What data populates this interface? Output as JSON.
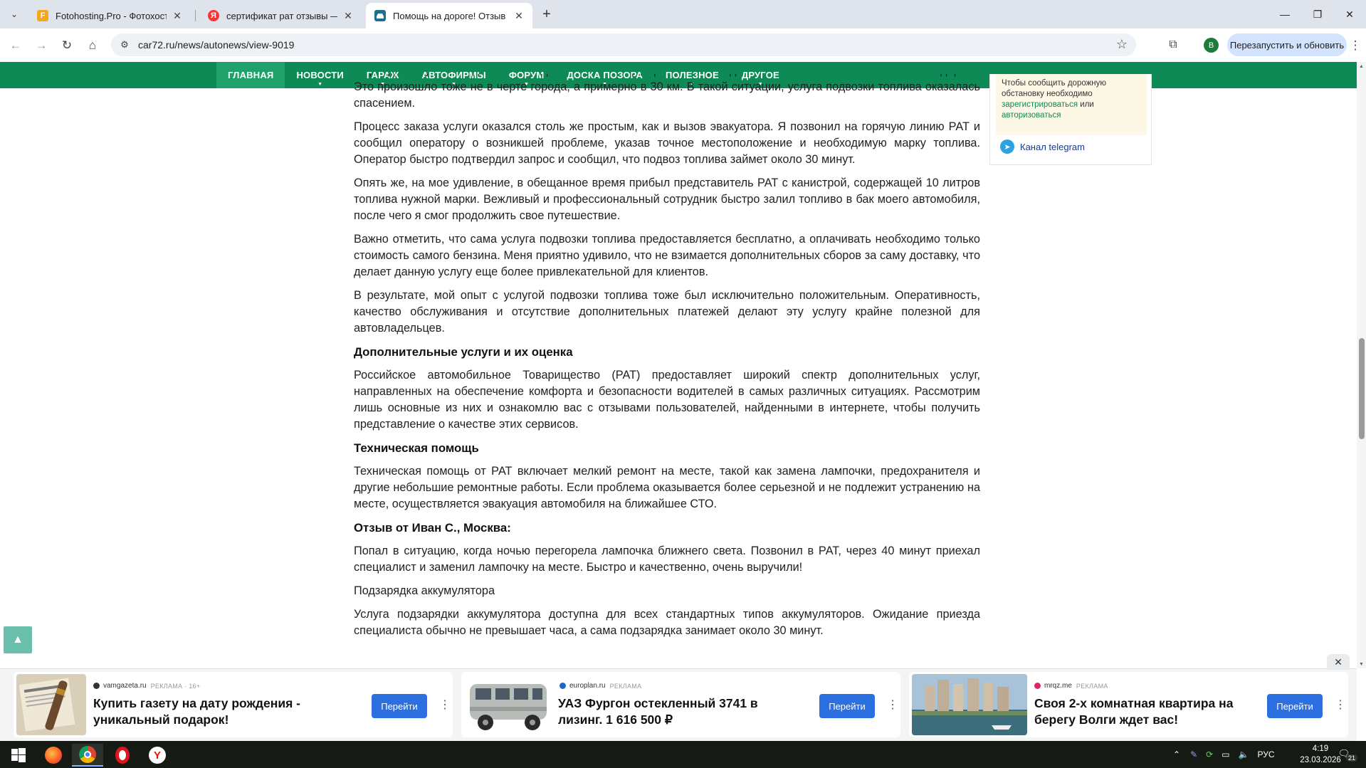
{
  "browser": {
    "tabs": [
      {
        "title": "Fotohosting.Pro - Фотохостинг",
        "favicon_color": "#f2a81d",
        "favicon_text": "F",
        "active": false
      },
      {
        "title": "сертификат рат отзывы — Янд",
        "favicon_color": "#ff3333",
        "favicon_text": "Я",
        "active": false
      },
      {
        "title": "Помощь на дороге! Отзыв о к",
        "favicon_color": "#1d6f8b",
        "favicon_text": "",
        "active": true
      }
    ],
    "url": "car72.ru/news/autonews/view-9019",
    "profile_initial": "B",
    "relaunch_label": "Перезапустить и обновить"
  },
  "nav": {
    "items": [
      {
        "label": "ГЛАВНАЯ",
        "active": true,
        "caret": false
      },
      {
        "label": "НОВОСТИ",
        "active": false,
        "caret": true
      },
      {
        "label": "ГАРАЖ",
        "active": false,
        "caret": true
      },
      {
        "label": "АВТОФИРМЫ",
        "active": false,
        "caret": true
      },
      {
        "label": "ФОРУМ",
        "active": false,
        "caret": true
      },
      {
        "label": "ДОСКА ПОЗОРА",
        "active": false,
        "caret": true
      },
      {
        "label": "ПОЛЕЗНОЕ",
        "active": false,
        "caret": true
      },
      {
        "label": "ДРУГОЕ",
        "active": false,
        "caret": true
      }
    ]
  },
  "article": {
    "blocks": [
      {
        "type": "p",
        "text": "Еще один случай, когда мне понадобилась помощь, произошел, когда я внезапно остался без топлива в дороге. Это произошло тоже не в черте города, а примерно в 30 км. В такой ситуации, услуга подвозки топлива оказалась спасением."
      },
      {
        "type": "p",
        "text": "Процесс заказа услуги оказался столь же простым, как и вызов эвакуатора. Я позвонил на горячую линию РАТ и сообщил оператору о возникшей проблеме, указав точное местоположение и необходимую марку топлива. Оператор быстро подтвердил запрос и сообщил, что подвоз топлива займет около 30 минут."
      },
      {
        "type": "p",
        "text": "Опять же, на мое удивление, в обещанное время прибыл представитель РАТ с канистрой, содержащей 10 литров топлива нужной марки. Вежливый и профессиональный сотрудник быстро залил топливо в бак моего автомобиля, после чего я смог продолжить свое путешествие."
      },
      {
        "type": "p",
        "text": "Важно отметить, что сама услуга подвозки топлива предоставляется бесплатно, а оплачивать необходимо только стоимость самого бензина. Меня приятно удивило, что не взимается дополнительных сборов за саму доставку, что делает данную услугу еще более привлекательной для клиентов."
      },
      {
        "type": "p",
        "text": "В результате, мой опыт с услугой подвозки топлива тоже был исключительно положительным. Оперативность, качество обслуживания и отсутствие дополнительных платежей делают эту услугу крайне полезной для автовладельцев."
      },
      {
        "type": "h3",
        "text": "Дополнительные услуги и их оценка"
      },
      {
        "type": "p",
        "text": "Российское автомобильное Товарищество (РАТ) предоставляет широкий спектр дополнительных услуг, направленных на обеспечение комфорта и безопасности водителей в самых различных ситуациях. Рассмотрим лишь основные из них и ознакомлю вас с отзывами пользователей, найденными в интернете, чтобы получить представление о качестве этих сервисов."
      },
      {
        "type": "h3",
        "text": "Техническая помощь"
      },
      {
        "type": "p",
        "text": "Техническая помощь от РАТ включает мелкий ремонт на месте, такой как замена лампочки, предохранителя и другие небольшие ремонтные работы. Если проблема оказывается более серьезной и не подлежит устранению на месте, осуществляется эвакуация автомобиля на ближайшее СТО."
      },
      {
        "type": "h3",
        "text": "Отзыв от Иван С., Москва:"
      },
      {
        "type": "p",
        "text": "Попал в ситуацию, когда ночью перегорела лампочка ближнего света. Позвонил в РАТ, через 40 минут приехал специалист и заменил лампочку на месте. Быстро и качественно, очень выручили!"
      },
      {
        "type": "p",
        "text": "Подзарядка аккумулятора"
      },
      {
        "type": "p",
        "text": "Услуга подзарядки аккумулятора доступна для всех стандартных типов аккумуляторов. Ожидание приезда специалиста обычно не превышает часа, а сама подзарядка занимает около 30 минут."
      }
    ]
  },
  "sidebar": {
    "note_prefix": "Чтобы сообщить дорожную обстановку необходимо",
    "register_link": "зарегистрироваться",
    "or_text": "или",
    "login_link": "авторизоваться",
    "telegram_label": "Канал telegram"
  },
  "ads": [
    {
      "source": "vamgazeta.ru",
      "label": "РЕКЛАМА · 16+",
      "title": "Купить газету на дату рождения - уникальный подарок!",
      "button": "Перейти",
      "dot_color": "#333333"
    },
    {
      "source": "europlan.ru",
      "label": "РЕКЛАМА",
      "title": "УАЗ Фургон остекленный 3741 в лизинг. 1 616 500 ₽",
      "button": "Перейти",
      "dot_color": "#1e66c9"
    },
    {
      "source": "mrqz.me",
      "label": "РЕКЛАМА",
      "title": "Своя 2-х комнатная квартира на берегу Волги ждет вас!",
      "button": "Перейти",
      "dot_color": "#e0245e"
    }
  ],
  "taskbar": {
    "language": "РУС",
    "time": "4:19",
    "date": "23.03.2026",
    "notifications": "21"
  }
}
